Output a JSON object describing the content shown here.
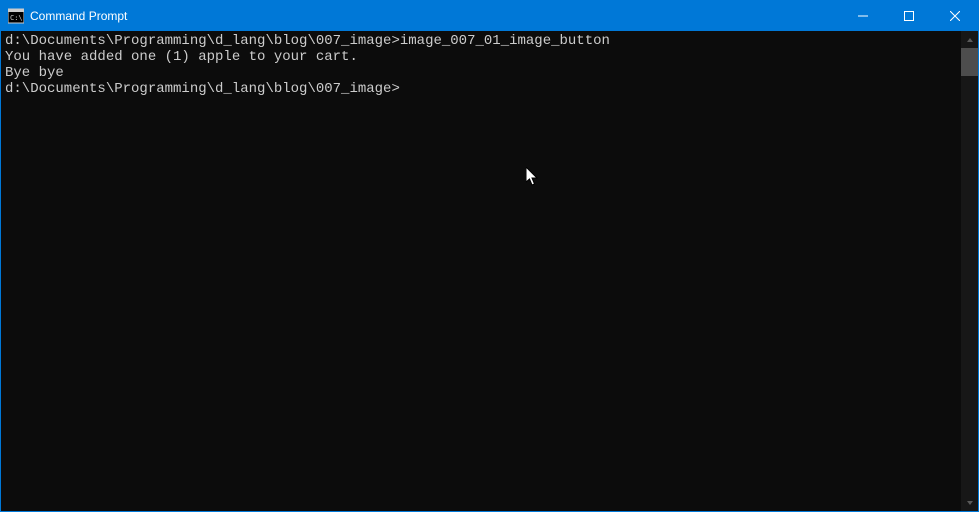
{
  "window": {
    "title": "Command Prompt"
  },
  "terminal": {
    "lines": [
      {
        "prompt": "d:\\Documents\\Programming\\d_lang\\blog\\007_image>",
        "command": "image_007_01_image_button"
      },
      {
        "text": "You have added one (1) apple to your cart."
      },
      {
        "text": "Bye bye"
      },
      {
        "text": ""
      },
      {
        "prompt": "d:\\Documents\\Programming\\d_lang\\blog\\007_image>",
        "command": ""
      }
    ]
  }
}
